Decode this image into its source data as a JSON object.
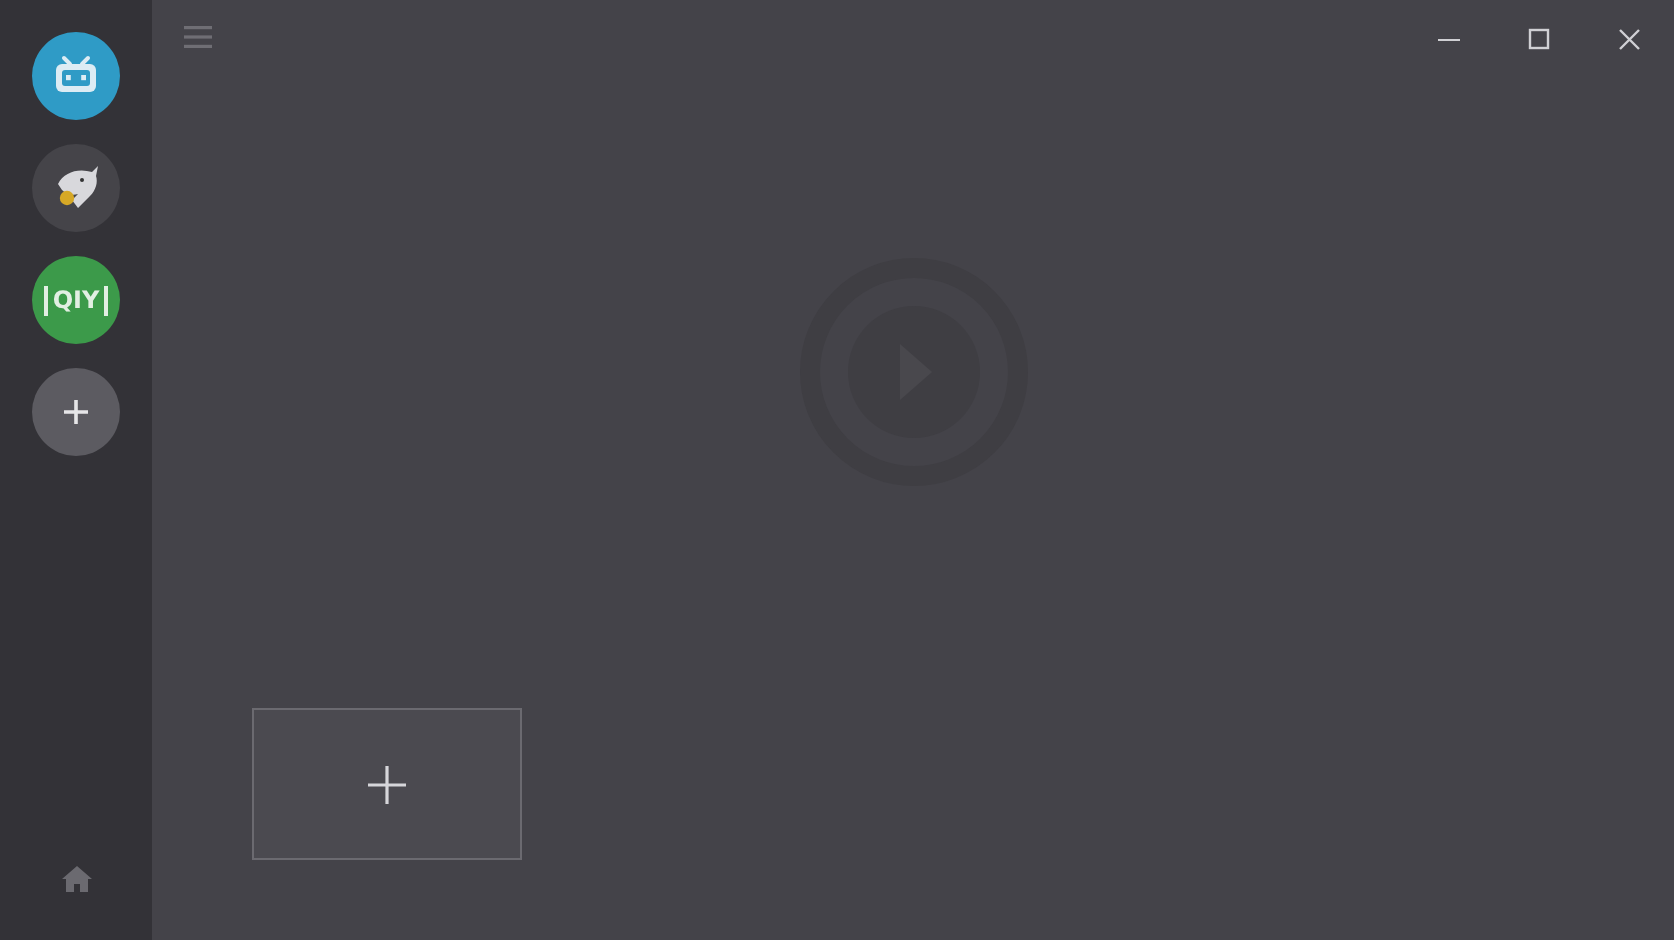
{
  "sidebar": {
    "items": [
      {
        "kind": "tv"
      },
      {
        "kind": "bird"
      },
      {
        "kind": "logo",
        "logo_text": "QIY"
      },
      {
        "kind": "add"
      }
    ],
    "bottom": {
      "kind": "home"
    }
  },
  "window_controls": [
    {
      "kind": "minimize"
    },
    {
      "kind": "maximize"
    },
    {
      "kind": "close"
    }
  ],
  "main": {
    "kind": "empty",
    "tiles": [
      {
        "kind": "add"
      }
    ]
  }
}
